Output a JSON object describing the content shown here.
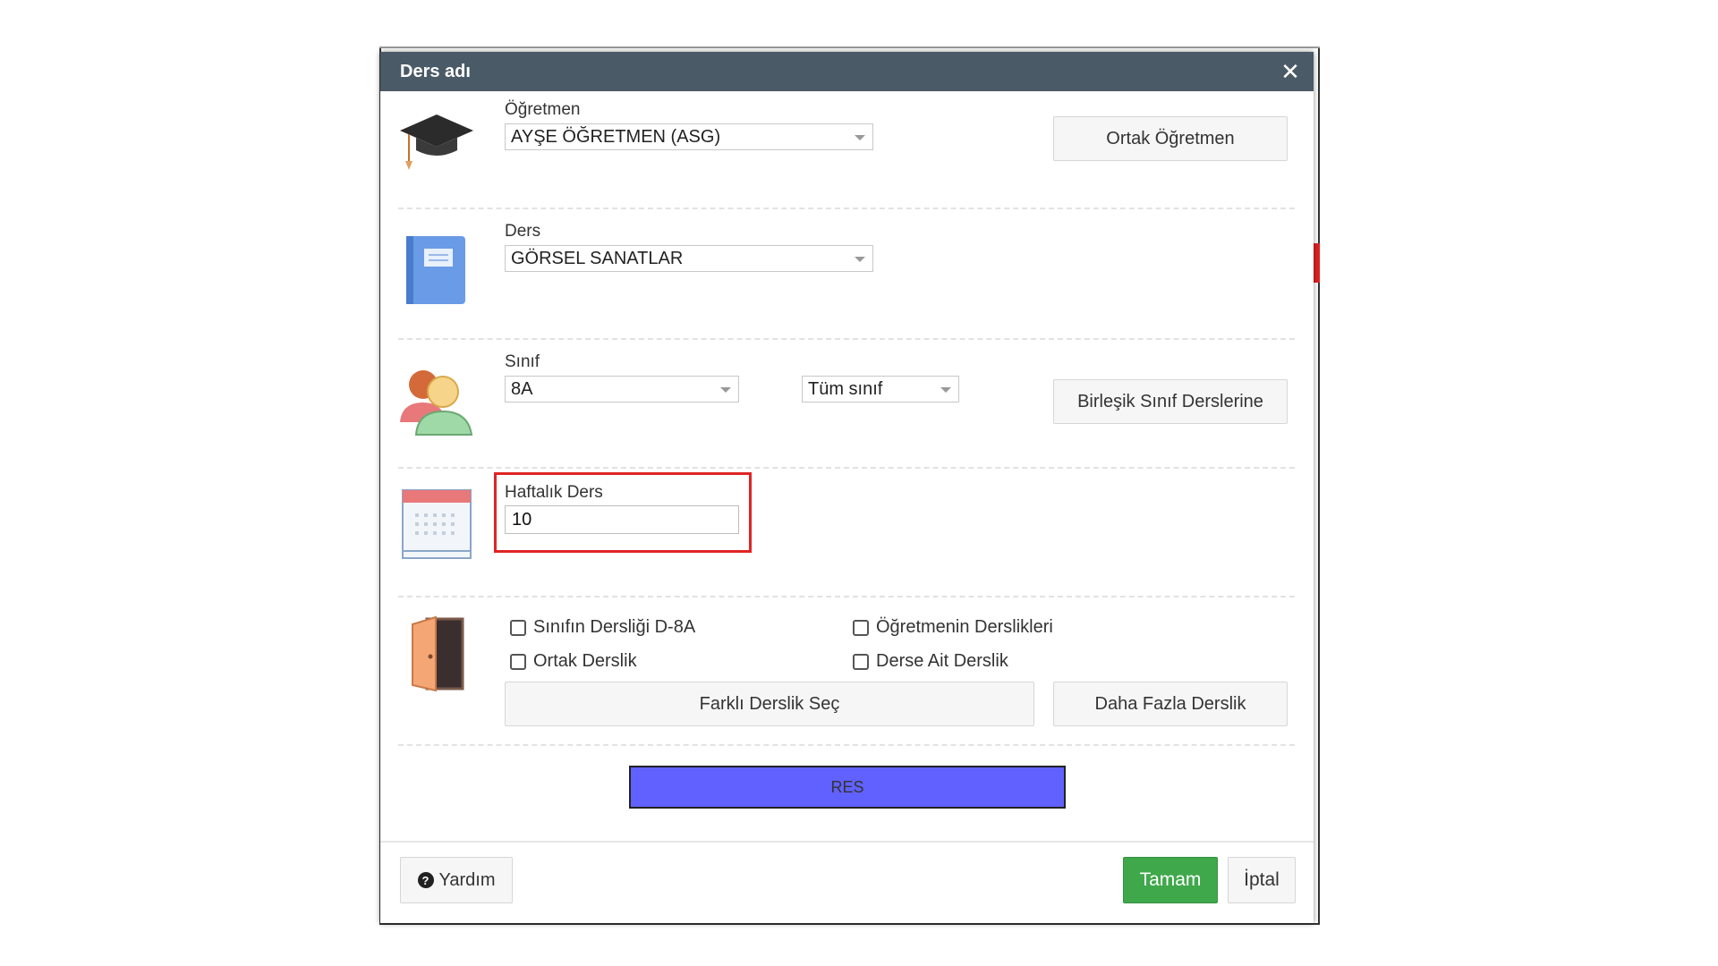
{
  "dialog": {
    "title": "Ders adı"
  },
  "teacher": {
    "label": "Öğretmen",
    "selected": "AYŞE ÖĞRETMEN (ASG)",
    "button": "Ortak Öğretmen",
    "icon": "graduation-cap-icon"
  },
  "course": {
    "label": "Ders",
    "selected": "GÖRSEL SANATLAR",
    "icon": "book-icon"
  },
  "class": {
    "label": "Sınıf",
    "selected": "8A",
    "scope_selected": "Tüm sınıf",
    "button": "Birleşik Sınıf Derslerine",
    "icon": "students-icon"
  },
  "weekly": {
    "label": "Haftalık Ders",
    "value": "10",
    "icon": "calendar-icon"
  },
  "classroom": {
    "icon": "door-icon",
    "options": [
      {
        "label": "Sınıfın Dersliği D-8A",
        "checked": false
      },
      {
        "label": "Öğretmenin Derslikleri",
        "checked": false
      },
      {
        "label": "Ortak Derslik",
        "checked": false
      },
      {
        "label": "Derse Ait Derslik",
        "checked": false
      }
    ],
    "select_button": "Farklı Derslik Seç",
    "more_button": "Daha Fazla Derslik"
  },
  "res_bar": {
    "label": "RES",
    "color": "#6161ff"
  },
  "footer": {
    "help": "Yardım",
    "ok": "Tamam",
    "cancel": "İptal"
  },
  "colors": {
    "titlebar": "#4a5a66",
    "ok_button": "#3fa84b",
    "highlight": "#e02424"
  }
}
